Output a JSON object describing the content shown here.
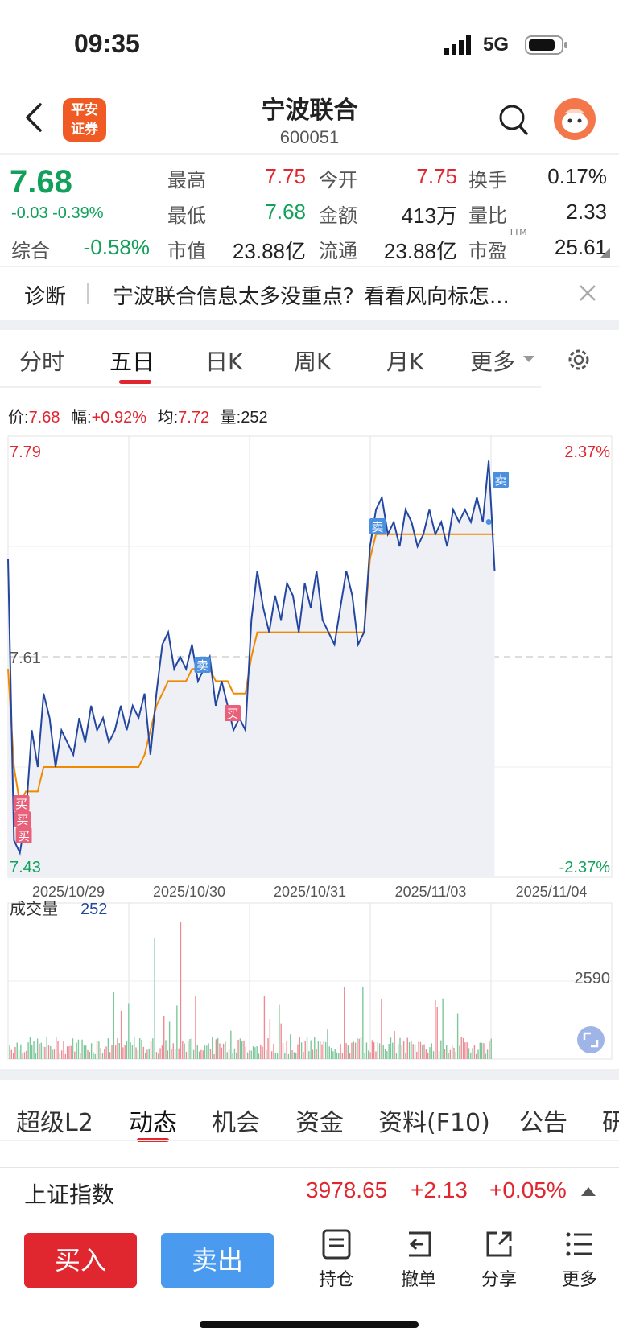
{
  "status_bar": {
    "time": "09:35",
    "network": "5G"
  },
  "header": {
    "logo_text": "平安\n证券",
    "stock_name": "宁波联合",
    "stock_code": "600051"
  },
  "quote": {
    "price": "7.68",
    "change": "-0.03  -0.39%",
    "composite_label": "综合",
    "composite_value": "-0.58%",
    "fields": [
      {
        "label": "最高",
        "value": "7.75"
      },
      {
        "label": "今开",
        "value": "7.75"
      },
      {
        "label": "换手",
        "value": "0.17%"
      },
      {
        "label": "最低",
        "value": "7.68"
      },
      {
        "label": "金额",
        "value": "413万"
      },
      {
        "label": "量比",
        "value": "2.33"
      },
      {
        "label": "市值",
        "value": "23.88亿"
      },
      {
        "label": "流通",
        "value": "23.88亿"
      },
      {
        "label": "市盈",
        "value": "25.61"
      }
    ],
    "ttm": "TTM"
  },
  "diagnosis": {
    "label": "诊断",
    "text": "宁波联合信息太多没重点？看看风向标怎..."
  },
  "chart_tabs": [
    "分时",
    "五日",
    "日K",
    "周K",
    "月K",
    "更多"
  ],
  "active_chart_tab": "五日",
  "info_bar": {
    "price_label": "价:",
    "price": "7.68",
    "amp_label": "幅:",
    "amp": "+0.92%",
    "avg_label": "均:",
    "avg": "7.72",
    "vol_label": "量:",
    "vol": "252"
  },
  "chart_data": {
    "type": "line",
    "title": "",
    "x_dates": [
      "2025/10/29",
      "2025/10/30",
      "2025/10/31",
      "2025/11/03",
      "2025/11/04"
    ],
    "ylim": [
      7.43,
      7.79
    ],
    "y_labels": {
      "top": "7.79",
      "mid": "7.61",
      "bottom": "7.43"
    },
    "pct_labels": {
      "top": "2.37%",
      "bottom": "-2.37%"
    },
    "reference_line": 7.61,
    "current_price_line": 7.72,
    "series": [
      {
        "values": [
          7.69,
          7.46,
          7.45,
          7.48,
          7.55,
          7.52,
          7.58,
          7.56,
          7.52,
          7.55,
          7.54,
          7.53,
          7.56,
          7.54,
          7.57,
          7.55,
          7.56,
          7.54,
          7.55,
          7.57,
          7.55,
          7.57,
          7.56,
          7.58,
          7.53,
          7.58,
          7.62,
          7.63,
          7.6,
          7.61,
          7.6,
          7.62,
          7.59,
          7.6,
          7.61,
          7.57,
          7.59,
          7.57,
          7.55,
          7.56,
          7.55,
          7.64,
          7.68,
          7.65,
          7.63,
          7.66,
          7.64,
          7.67,
          7.66,
          7.63,
          7.67,
          7.65,
          7.68,
          7.64,
          7.63,
          7.62,
          7.65,
          7.68,
          7.66,
          7.62,
          7.63,
          7.7,
          7.73,
          7.74,
          7.71,
          7.72,
          7.7,
          7.73,
          7.72,
          7.7,
          7.71,
          7.73,
          7.71,
          7.72,
          7.7,
          7.73,
          7.72,
          7.73,
          7.72,
          7.74,
          7.72,
          7.77,
          7.68
        ]
      },
      {
        "values": [
          7.6,
          7.52,
          7.49,
          7.5,
          7.5,
          7.5,
          7.52,
          7.52,
          7.52,
          7.52,
          7.52,
          7.52,
          7.52,
          7.52,
          7.52,
          7.52,
          7.52,
          7.52,
          7.52,
          7.52,
          7.52,
          7.52,
          7.52,
          7.53,
          7.55,
          7.57,
          7.58,
          7.59,
          7.59,
          7.59,
          7.59,
          7.6,
          7.6,
          7.6,
          7.6,
          7.59,
          7.59,
          7.59,
          7.58,
          7.58,
          7.58,
          7.61,
          7.63,
          7.63,
          7.63,
          7.63,
          7.63,
          7.63,
          7.63,
          7.63,
          7.63,
          7.63,
          7.63,
          7.63,
          7.63,
          7.63,
          7.63,
          7.63,
          7.63,
          7.63,
          7.63,
          7.69,
          7.71,
          7.71,
          7.71,
          7.71,
          7.71,
          7.71,
          7.71,
          7.71,
          7.71,
          7.71,
          7.71,
          7.71,
          7.71,
          7.71,
          7.71,
          7.71,
          7.71,
          7.71,
          7.71,
          7.71,
          7.71
        ]
      }
    ],
    "markers": [
      {
        "text": "买",
        "type": "buy",
        "day": 0,
        "pos": 0.05
      },
      {
        "text": "买",
        "type": "buy",
        "day": 0,
        "pos": 0.06
      },
      {
        "text": "买",
        "type": "buy",
        "day": 0,
        "pos": 0.07
      },
      {
        "text": "卖",
        "type": "sell",
        "day": 1,
        "pos": 0.55
      },
      {
        "text": "买",
        "type": "buy",
        "day": 1,
        "pos": 0.8
      },
      {
        "text": "卖",
        "type": "sell",
        "day": 3,
        "pos": 0.0
      },
      {
        "text": "卖",
        "type": "sell",
        "day": 4,
        "pos": 0.02
      }
    ],
    "volume": {
      "label": "成交量",
      "current": "252",
      "max_label": "2590"
    }
  },
  "colors": {
    "accent_red": "#e0262e",
    "green": "#12a05a",
    "price_line": "#2347a0",
    "avg_line": "#f08a00",
    "sell_blue": "#4a8fe0"
  },
  "bottom_tabs": [
    "超级L2",
    "动态",
    "机会",
    "资金",
    "资料(F10)",
    "公告",
    "研"
  ],
  "active_bottom_tab": "动态",
  "index_bar": {
    "name": "上证指数",
    "value": "3978.65",
    "change": "+2.13",
    "pct": "+0.05%"
  },
  "actions": {
    "buy": "买入",
    "sell": "卖出",
    "items": [
      "持仓",
      "撤单",
      "分享",
      "更多"
    ]
  }
}
